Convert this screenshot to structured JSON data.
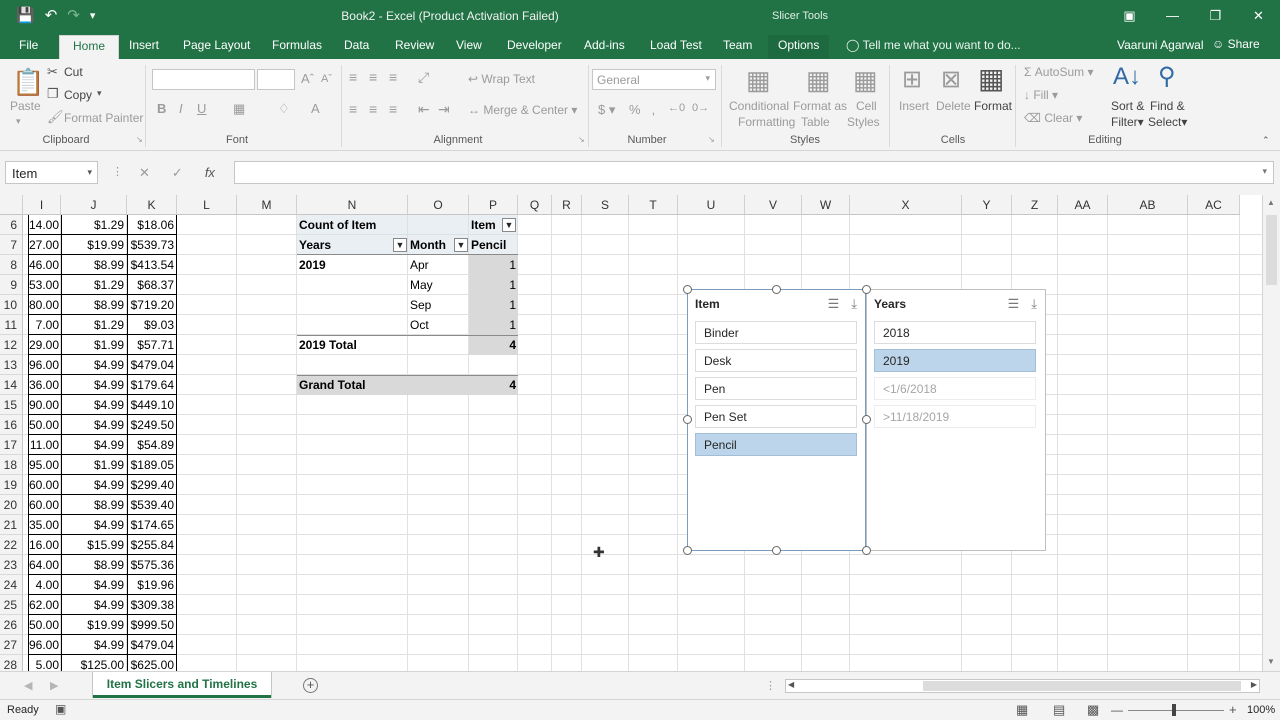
{
  "titlebar": {
    "title": "Book2 - Excel (Product Activation Failed)",
    "context": "Slicer Tools"
  },
  "tabs": [
    "File",
    "Home",
    "Insert",
    "Page Layout",
    "Formulas",
    "Data",
    "Review",
    "View",
    "Developer",
    "Add-ins",
    "Load Test",
    "Team",
    "Options"
  ],
  "tell_me": "Tell me what you want to do...",
  "user": "Vaaruni Agarwal",
  "share": "Share",
  "ribbon": {
    "clipboard": {
      "paste": "Paste",
      "cut": "Cut",
      "copy": "Copy",
      "format_painter": "Format Painter",
      "label": "Clipboard"
    },
    "font": {
      "label": "Font"
    },
    "alignment": {
      "wrap": "Wrap Text",
      "merge": "Merge & Center",
      "label": "Alignment"
    },
    "number": {
      "format": "General",
      "label": "Number"
    },
    "styles": {
      "cond": "Conditional",
      "cond2": "Formatting",
      "fmt_table": "Format as",
      "fmt_table2": "Table",
      "cell": "Cell",
      "cell2": "Styles",
      "label": "Styles"
    },
    "cells": {
      "insert": "Insert",
      "delete": "Delete",
      "format": "Format",
      "label": "Cells"
    },
    "editing": {
      "autosum": "AutoSum",
      "fill": "Fill",
      "clear": "Clear",
      "sort": "Sort &",
      "sort2": "Filter",
      "find": "Find &",
      "find2": "Select",
      "label": "Editing"
    }
  },
  "namebox": "Item",
  "columns": [
    "I",
    "J",
    "K",
    "L",
    "M",
    "N",
    "O",
    "P",
    "Q",
    "R",
    "S",
    "T",
    "U",
    "V",
    "W",
    "X",
    "Y",
    "Z",
    "AA",
    "AB",
    "AC"
  ],
  "rows": [
    {
      "n": "6",
      "i": "14.00",
      "j": "$1.29",
      "k": "$18.06"
    },
    {
      "n": "7",
      "i": "27.00",
      "j": "$19.99",
      "k": "$539.73"
    },
    {
      "n": "8",
      "i": "46.00",
      "j": "$8.99",
      "k": "$413.54"
    },
    {
      "n": "9",
      "i": "53.00",
      "j": "$1.29",
      "k": "$68.37"
    },
    {
      "n": "10",
      "i": "80.00",
      "j": "$8.99",
      "k": "$719.20"
    },
    {
      "n": "11",
      "i": "7.00",
      "j": "$1.29",
      "k": "$9.03"
    },
    {
      "n": "12",
      "i": "29.00",
      "j": "$1.99",
      "k": "$57.71"
    },
    {
      "n": "13",
      "i": "96.00",
      "j": "$4.99",
      "k": "$479.04"
    },
    {
      "n": "14",
      "i": "36.00",
      "j": "$4.99",
      "k": "$179.64"
    },
    {
      "n": "15",
      "i": "90.00",
      "j": "$4.99",
      "k": "$449.10"
    },
    {
      "n": "16",
      "i": "50.00",
      "j": "$4.99",
      "k": "$249.50"
    },
    {
      "n": "17",
      "i": "11.00",
      "j": "$4.99",
      "k": "$54.89"
    },
    {
      "n": "18",
      "i": "95.00",
      "j": "$1.99",
      "k": "$189.05"
    },
    {
      "n": "19",
      "i": "60.00",
      "j": "$4.99",
      "k": "$299.40"
    },
    {
      "n": "20",
      "i": "60.00",
      "j": "$8.99",
      "k": "$539.40"
    },
    {
      "n": "21",
      "i": "35.00",
      "j": "$4.99",
      "k": "$174.65"
    },
    {
      "n": "22",
      "i": "16.00",
      "j": "$15.99",
      "k": "$255.84"
    },
    {
      "n": "23",
      "i": "64.00",
      "j": "$8.99",
      "k": "$575.36"
    },
    {
      "n": "24",
      "i": "4.00",
      "j": "$4.99",
      "k": "$19.96"
    },
    {
      "n": "25",
      "i": "62.00",
      "j": "$4.99",
      "k": "$309.38"
    },
    {
      "n": "26",
      "i": "50.00",
      "j": "$19.99",
      "k": "$999.50"
    },
    {
      "n": "27",
      "i": "96.00",
      "j": "$4.99",
      "k": "$479.04"
    },
    {
      "n": "28",
      "i": "5.00",
      "j": "$125.00",
      "k": "$625.00"
    }
  ],
  "pivot": {
    "count_of": "Count of Item",
    "item_hdr": "Item",
    "years_hdr": "Years",
    "month_hdr": "Month",
    "pencil_hdr": "Pencil",
    "year": "2019",
    "months": [
      {
        "m": "Apr",
        "v": "1"
      },
      {
        "m": "May",
        "v": "1"
      },
      {
        "m": "Sep",
        "v": "1"
      },
      {
        "m": "Oct",
        "v": "1"
      }
    ],
    "subtotal_label": "2019 Total",
    "subtotal": "4",
    "grand_label": "Grand Total",
    "grand": "4"
  },
  "slicer_item": {
    "title": "Item",
    "items": [
      {
        "label": "Binder",
        "state": "normal"
      },
      {
        "label": "Desk",
        "state": "normal"
      },
      {
        "label": "Pen",
        "state": "normal"
      },
      {
        "label": "Pen Set",
        "state": "normal"
      },
      {
        "label": "Pencil",
        "state": "selected"
      }
    ]
  },
  "slicer_years": {
    "title": "Years",
    "items": [
      {
        "label": "2018",
        "state": "normal"
      },
      {
        "label": "2019",
        "state": "selected"
      },
      {
        "label": "<1/6/2018",
        "state": "nodata"
      },
      {
        "label": ">11/18/2019",
        "state": "nodata"
      }
    ]
  },
  "sheet_tab": "Item Slicers and Timelines",
  "status": {
    "ready": "Ready",
    "zoom": "100%"
  }
}
